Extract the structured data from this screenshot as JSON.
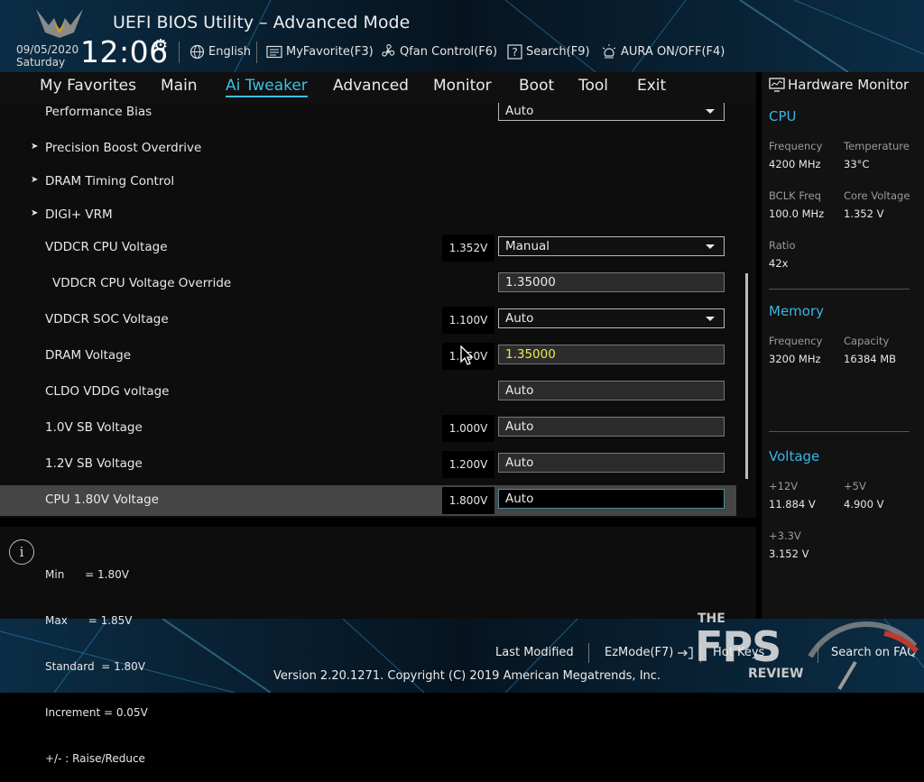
{
  "header": {
    "title": "UEFI BIOS Utility – Advanced Mode",
    "date": "09/05/2020",
    "day": "Saturday",
    "time": "12:06",
    "tools": {
      "language": "English",
      "myfavorite": "MyFavorite(F3)",
      "qfan": "Qfan Control(F6)",
      "search": "Search(F9)",
      "aura": "AURA ON/OFF(F4)"
    }
  },
  "menu": {
    "tabs": [
      "My Favorites",
      "Main",
      "Ai Tweaker",
      "Advanced",
      "Monitor",
      "Boot",
      "Tool",
      "Exit"
    ],
    "active": "Ai Tweaker"
  },
  "settings": [
    {
      "label": "Performance Bias",
      "value": "Auto",
      "dropdown": true
    },
    {
      "label": "Precision Boost Overdrive",
      "submenu": true
    },
    {
      "label": "DRAM Timing Control",
      "submenu": true
    },
    {
      "label": "DIGI+ VRM",
      "submenu": true
    },
    {
      "label": "VDDCR CPU Voltage",
      "current": "1.352V",
      "value": "Manual",
      "dropdown": true
    },
    {
      "label": "VDDCR CPU Voltage Override",
      "value": "1.35000"
    },
    {
      "label": "VDDCR SOC Voltage",
      "current": "1.100V",
      "value": "Auto",
      "dropdown": true
    },
    {
      "label": "DRAM Voltage",
      "current": "1.350V",
      "value": "1.35000",
      "highlight": true
    },
    {
      "label": "CLDO VDDG voltage",
      "value": "Auto"
    },
    {
      "label": "1.0V SB Voltage",
      "current": "1.000V",
      "value": "Auto"
    },
    {
      "label": "1.2V SB Voltage",
      "current": "1.200V",
      "value": "Auto"
    },
    {
      "label": "CPU 1.80V Voltage",
      "current": "1.800V",
      "value": "Auto",
      "selected": true
    }
  ],
  "help": {
    "lines": [
      "Min      = 1.80V",
      "Max      = 1.85V",
      "Standard  = 1.80V",
      "Increment = 0.05V",
      "+/- : Raise/Reduce"
    ]
  },
  "hardware_monitor": {
    "title": "Hardware Monitor",
    "cpu": {
      "title": "CPU",
      "frequency_label": "Frequency",
      "frequency": "4200 MHz",
      "temperature_label": "Temperature",
      "temperature": "33°C",
      "bclk_label": "BCLK Freq",
      "bclk": "100.0 MHz",
      "core_voltage_label": "Core Voltage",
      "core_voltage": "1.352 V",
      "ratio_label": "Ratio",
      "ratio": "42x"
    },
    "memory": {
      "title": "Memory",
      "frequency_label": "Frequency",
      "frequency": "3200 MHz",
      "capacity_label": "Capacity",
      "capacity": "16384 MB"
    },
    "voltage": {
      "title": "Voltage",
      "v12_label": "+12V",
      "v12": "11.884 V",
      "v5_label": "+5V",
      "v5": "4.900 V",
      "v33_label": "+3.3V",
      "v33": "3.152 V"
    }
  },
  "footer": {
    "last_modified": "Last Modified",
    "ezmode": "EzMode(F7)",
    "hotkeys": "Hot Keys",
    "search_faq": "Search on FAQ",
    "version": "Version 2.20.1271. Copyright (C) 2019 American Megatrends, Inc."
  },
  "watermark": {
    "the": "THE",
    "fps": "FPS",
    "review": "REVIEW"
  },
  "colors": {
    "accent": "#3bc0e8",
    "highlight_value": "#f2e84a",
    "selected_row": "#454545"
  }
}
